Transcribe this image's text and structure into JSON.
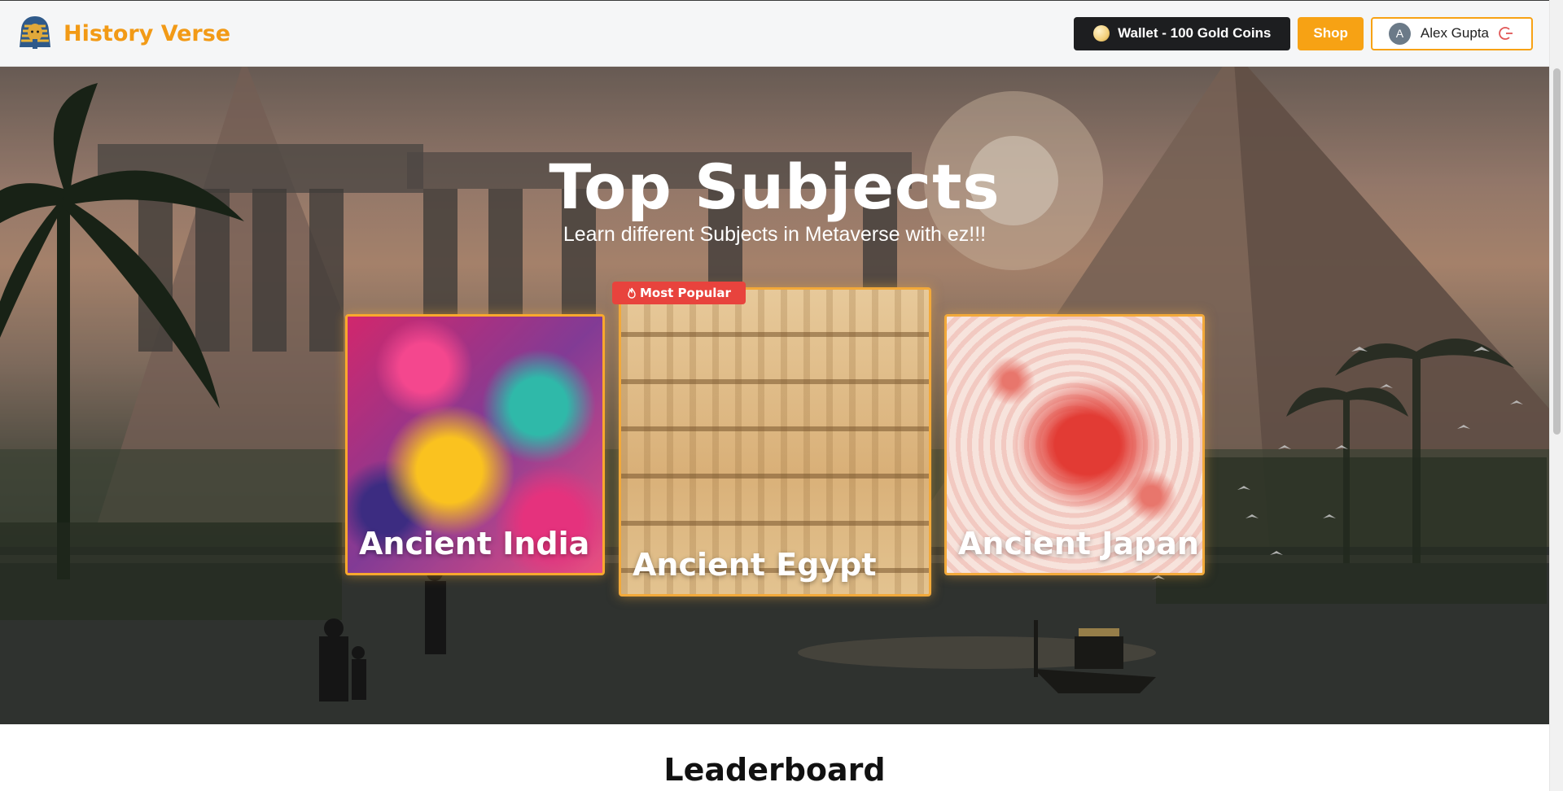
{
  "brand": {
    "name": "History Verse",
    "logo_icon": "pharaoh-mask-icon"
  },
  "header": {
    "wallet_label": "Wallet - 100 Gold Coins",
    "shop_label": "Shop",
    "user": {
      "avatar_initial": "A",
      "name": "Alex Gupta"
    }
  },
  "hero": {
    "title": "Top Subjects",
    "subtitle": "Learn different Subjects in Metaverse with ez!!!",
    "badge": "Most Popular",
    "subjects": [
      {
        "name": "Ancient India"
      },
      {
        "name": "Ancient Egypt"
      },
      {
        "name": "Ancient Japan"
      }
    ]
  },
  "sections": {
    "leaderboard_title": "Leaderboard"
  },
  "colors": {
    "accent": "#f7a214",
    "badge": "#e8433d",
    "wallet_bg": "#1d1e20"
  }
}
